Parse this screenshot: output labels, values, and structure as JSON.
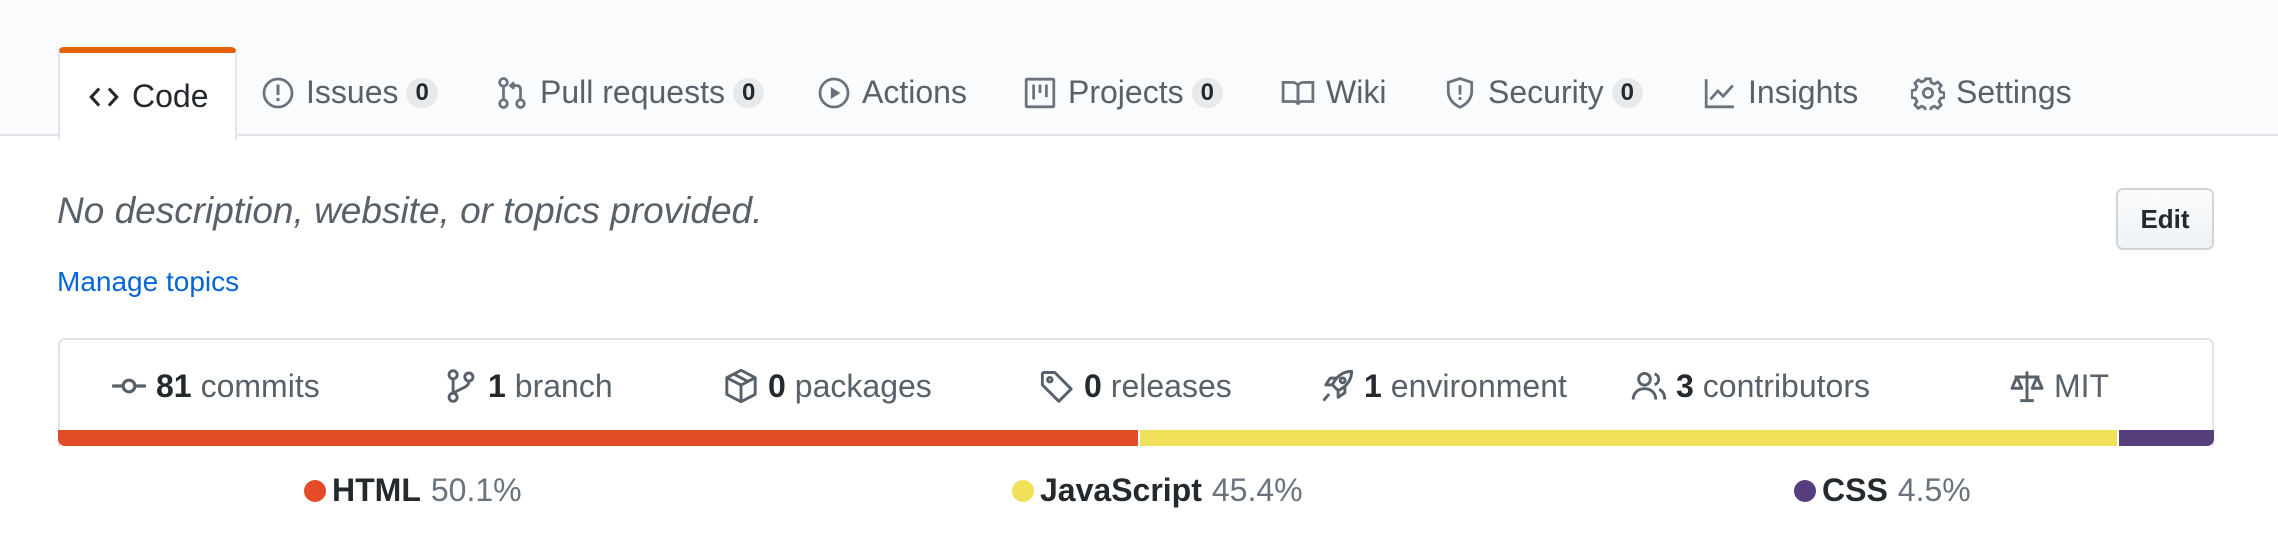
{
  "tabs": [
    {
      "label": "Code",
      "icon": "code-icon",
      "active": true
    },
    {
      "label": "Issues",
      "icon": "issue-icon",
      "count": "0"
    },
    {
      "label": "Pull requests",
      "icon": "pull-request-icon",
      "count": "0"
    },
    {
      "label": "Actions",
      "icon": "play-icon"
    },
    {
      "label": "Projects",
      "icon": "project-icon",
      "count": "0"
    },
    {
      "label": "Wiki",
      "icon": "book-icon"
    },
    {
      "label": "Security",
      "icon": "shield-icon",
      "count": "0"
    },
    {
      "label": "Insights",
      "icon": "graph-icon"
    },
    {
      "label": "Settings",
      "icon": "gear-icon"
    }
  ],
  "about": {
    "description": "No description, website, or topics provided.",
    "manage_topics": "Manage topics",
    "edit_label": "Edit"
  },
  "stats": [
    {
      "num": "81",
      "label": "commits",
      "icon": "commit-icon"
    },
    {
      "num": "1",
      "label": "branch",
      "icon": "branch-icon"
    },
    {
      "num": "0",
      "label": "packages",
      "icon": "package-icon"
    },
    {
      "num": "0",
      "label": "releases",
      "icon": "tag-icon"
    },
    {
      "num": "1",
      "label": "environment",
      "icon": "rocket-icon"
    },
    {
      "num": "3",
      "label": "contributors",
      "icon": "people-icon"
    },
    {
      "num": "",
      "label": "MIT",
      "icon": "law-icon"
    }
  ],
  "languages": [
    {
      "name": "HTML",
      "percent": "50.1%",
      "share": 50.1,
      "color": "#e34c26"
    },
    {
      "name": "JavaScript",
      "percent": "45.4%",
      "share": 45.4,
      "color": "#f1e05a"
    },
    {
      "name": "CSS",
      "percent": "4.5%",
      "share": 4.5,
      "color": "#563d7c"
    }
  ]
}
